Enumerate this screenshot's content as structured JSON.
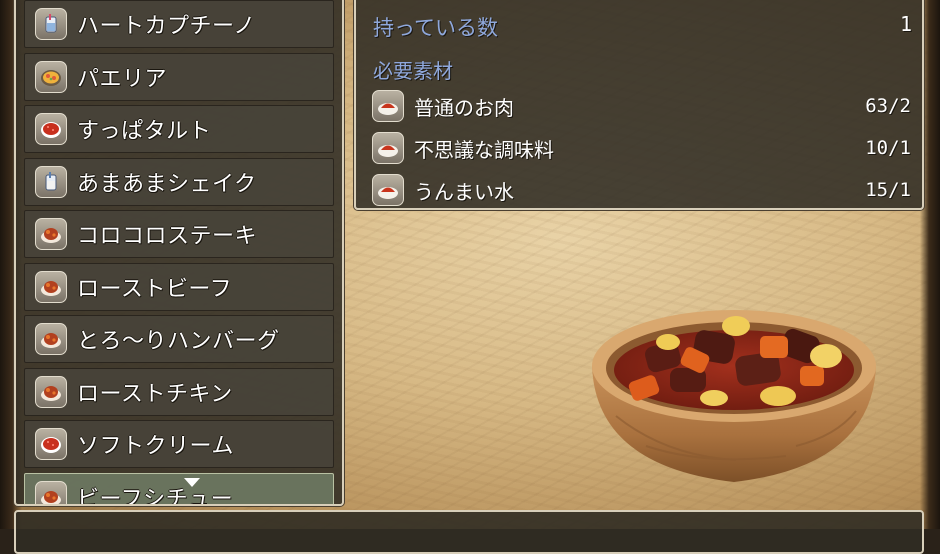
{
  "item_list": {
    "items": [
      {
        "label": "ハートカプチーノ",
        "icon": "cup-drink-icon"
      },
      {
        "label": "パエリア",
        "icon": "paella-icon"
      },
      {
        "label": "すっぱタルト",
        "icon": "tart-icon"
      },
      {
        "label": "あまあまシェイク",
        "icon": "cup-drink-icon"
      },
      {
        "label": "コロコロステーキ",
        "icon": "meat-dish-icon"
      },
      {
        "label": "ローストビーフ",
        "icon": "meat-dish-icon"
      },
      {
        "label": "とろ〜りハンバーグ",
        "icon": "meat-dish-icon"
      },
      {
        "label": "ローストチキン",
        "icon": "meat-dish-icon"
      },
      {
        "label": "ソフトクリーム",
        "icon": "tart-icon"
      },
      {
        "label": "ビーフシチュー",
        "icon": "meat-dish-icon"
      }
    ],
    "selected_index": 9
  },
  "detail": {
    "owned_label": "持っている数",
    "owned_value": "1",
    "materials_heading": "必要素材",
    "materials": [
      {
        "name": "普通のお肉",
        "count": "63/2",
        "icon": "ingredient-icon"
      },
      {
        "name": "不思議な調味料",
        "count": "10/1",
        "icon": "ingredient-icon"
      },
      {
        "name": "うんまい水",
        "count": "15/1",
        "icon": "ingredient-icon"
      }
    ]
  },
  "illustration": {
    "icon": "beef-stew-bowl-icon"
  },
  "colors": {
    "heading_blue": "#8fa8dc",
    "selected_row": "#6c7660"
  }
}
